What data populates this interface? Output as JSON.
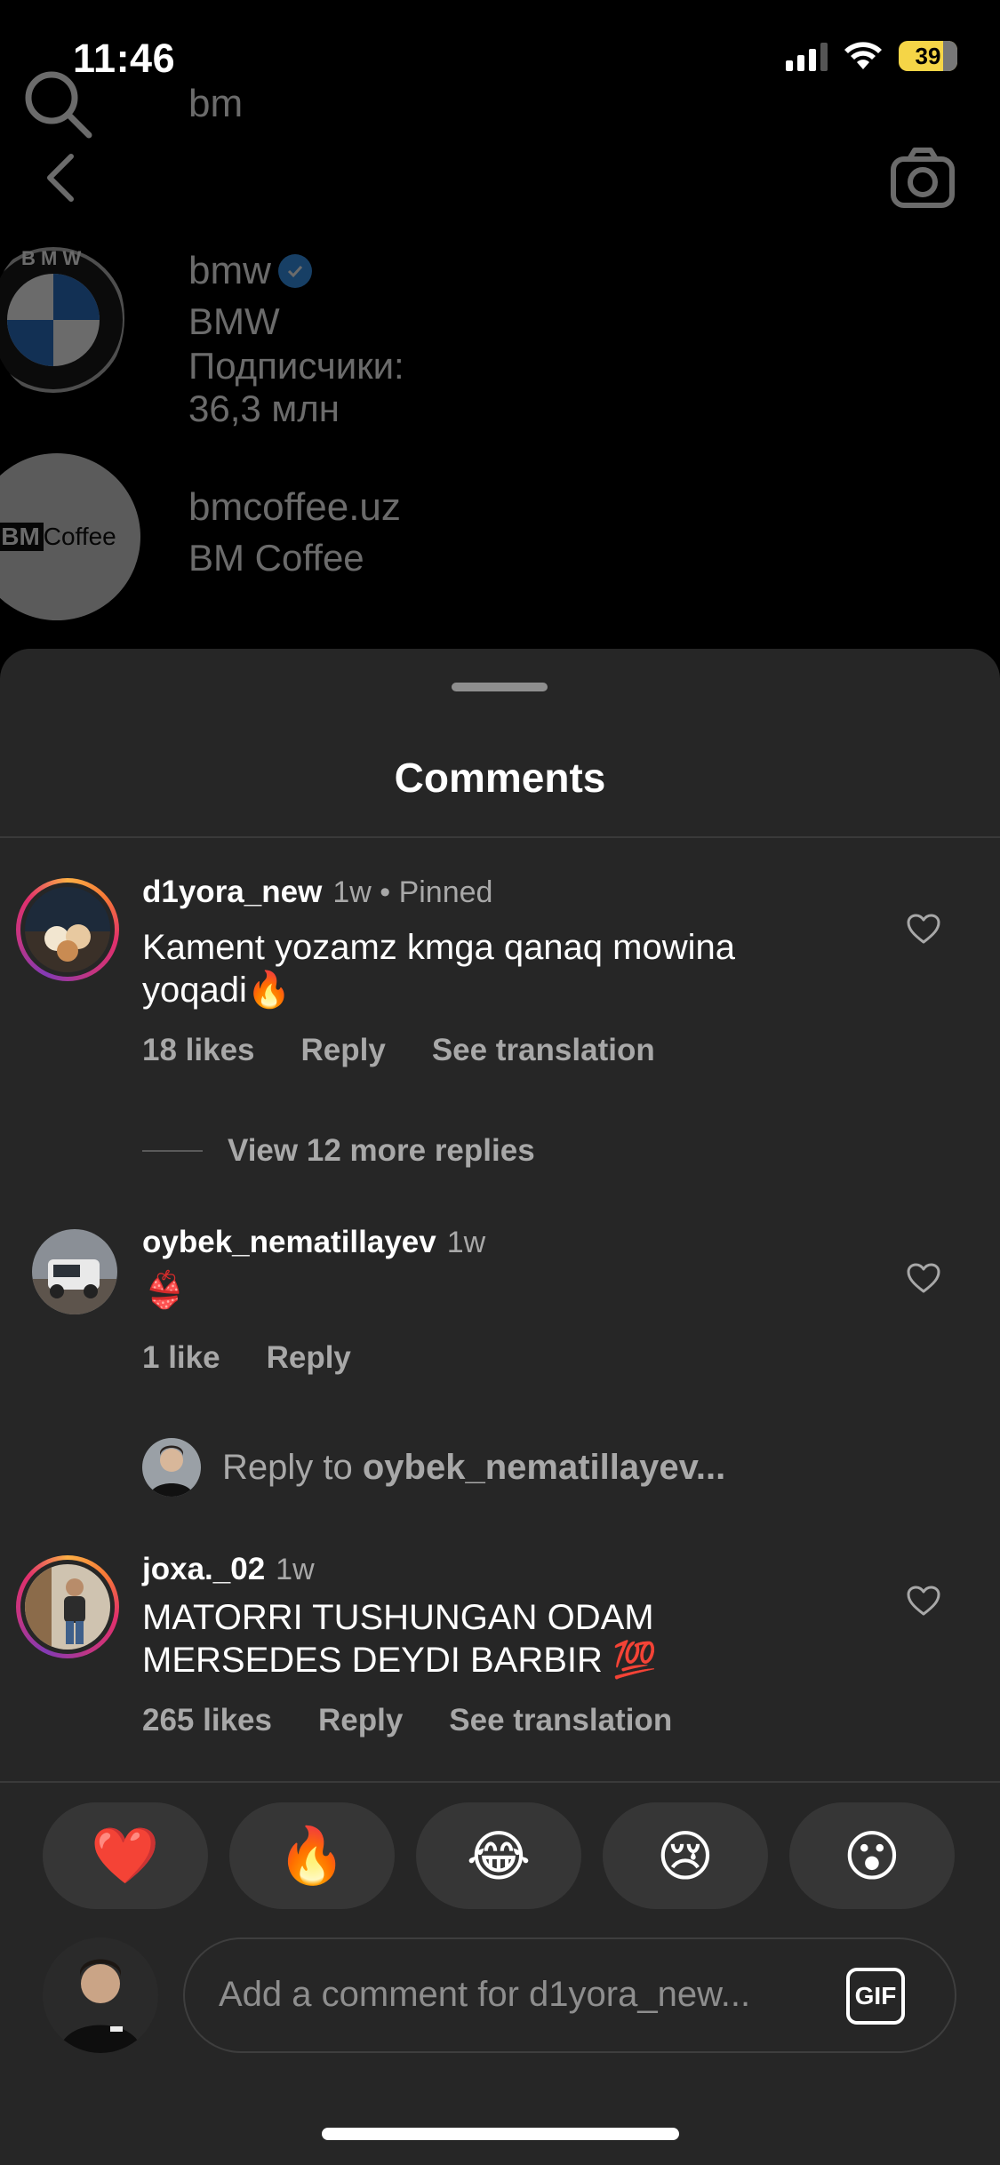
{
  "status_bar": {
    "time": "11:46",
    "battery": "39"
  },
  "search": {
    "query": "bm"
  },
  "results": [
    {
      "username": "bmw",
      "verified": true,
      "full_name": "BMW",
      "followers": "Подписчики: 36,3 млн"
    },
    {
      "username": "bmcoffee.uz",
      "verified": false,
      "full_name": "BM Coffee",
      "logo_text_a": "BM",
      "logo_text_b": "Coffee"
    }
  ],
  "sheet": {
    "title": "Comments"
  },
  "comments": [
    {
      "username": "d1yora_new",
      "meta": "1w • Pinned",
      "text": "Kament yozamz kmga qanaq mowina yoqadi🔥",
      "likes": "18 likes",
      "reply": "Reply",
      "translate": "See translation"
    },
    {
      "username": "oybek_nematillayev",
      "meta": "1w",
      "text": "👙",
      "likes": "1 like",
      "reply": "Reply"
    },
    {
      "username": "joxa._02",
      "meta": "1w",
      "text": "MATORRI TUSHUNGAN ODAM MERSEDES DEYDI BARBIR 💯",
      "likes": "265 likes",
      "reply": "Reply",
      "translate": "See translation"
    }
  ],
  "view_replies": "View 12 more replies",
  "reply_prompt": {
    "prefix": "Reply to ",
    "username": "oybek_nematillayev..."
  },
  "reactions": [
    "❤️",
    "🔥",
    "😂",
    "😢",
    "😮"
  ],
  "composer": {
    "placeholder": "Add a comment for d1yora_new...",
    "gif_label": "GIF"
  },
  "colors": {
    "sheet_bg": "#262626",
    "verified": "#3897f0",
    "battery": "#f5d547",
    "secondary_text": "#a8a8a8"
  }
}
